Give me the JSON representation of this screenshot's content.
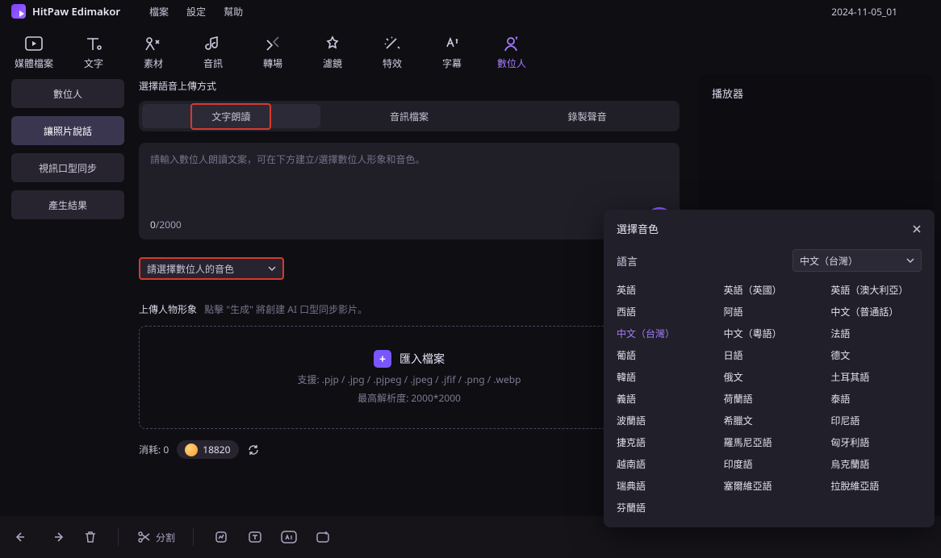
{
  "app": {
    "name": "HitPaw Edimakor",
    "timestamp": "2024-11-05_01"
  },
  "menus": {
    "file": "檔案",
    "settings": "設定",
    "help": "幫助"
  },
  "ribbon": {
    "media": "媒體檔案",
    "text": "文字",
    "sticker": "素材",
    "audio": "音訊",
    "transition": "轉場",
    "filter": "濾鏡",
    "effects": "特效",
    "subtitle": "字幕",
    "avatar": "數位人"
  },
  "sidebar": {
    "items": [
      {
        "label": "數位人"
      },
      {
        "label": "讓照片說話"
      },
      {
        "label": "視訊口型同步"
      },
      {
        "label": "產生結果"
      }
    ]
  },
  "main": {
    "section_title": "選擇語音上傳方式",
    "tabs": {
      "tts": "文字朗讀",
      "file": "音訊檔案",
      "record": "錄製聲音"
    },
    "script": {
      "placeholder": "請輸入數位人朗讀文案，可在下方建立/選擇數位人形象和音色。",
      "count": "0",
      "max": "/2000"
    },
    "voice": {
      "placeholder": "請選擇數位人的音色"
    },
    "upload": {
      "title": "上傳人物形象",
      "hint": "點擊 \"生成\" 將創建 AI 口型同步影片。",
      "button": "匯入檔案",
      "formats": "支援: .pjp / .jpg / .pjpeg / .jpeg / .jfif / .png / .webp",
      "resolution": "最高解析度: 2000*2000"
    },
    "credits": {
      "label": "消耗: 0",
      "balance": "18820"
    }
  },
  "player": {
    "title": "播放器"
  },
  "popup": {
    "title": "選擇音色",
    "lang_label": "語言",
    "lang_selected": "中文（台灣）",
    "langs": [
      "英語",
      "英語（英國）",
      "英語（澳大利亞）",
      "西語",
      "阿語",
      "中文（普通話）",
      "中文（台灣）",
      "中文（粵語）",
      "法語",
      "葡語",
      "日語",
      "德文",
      "韓語",
      "俄文",
      "土耳其語",
      "義語",
      "荷蘭語",
      "泰語",
      "波蘭語",
      "希臘文",
      "印尼語",
      "捷克語",
      "羅馬尼亞語",
      "匈牙利語",
      "越南語",
      "印度語",
      "烏克蘭語",
      "瑞典語",
      "塞爾維亞語",
      "拉脫維亞語",
      "芬蘭語"
    ],
    "active_lang": "中文（台灣）"
  },
  "bottom": {
    "split": "分割"
  }
}
